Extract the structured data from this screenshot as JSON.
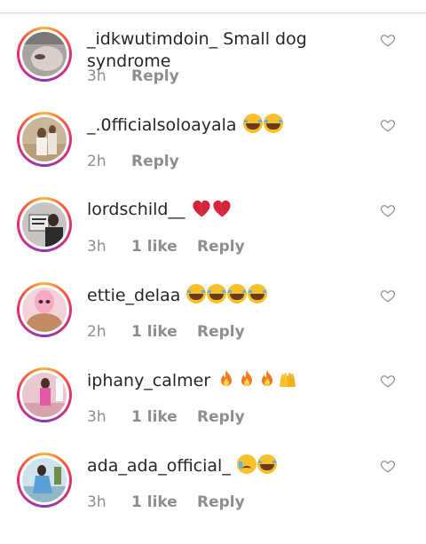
{
  "comments": [
    {
      "username": "_idkwutimdoin_",
      "text": "Small dog syndrome",
      "emojis": [],
      "time": "3h",
      "likes": "",
      "reply": "Reply",
      "avatar": "grey-face-avatar"
    },
    {
      "username": "_.0fficialsoloayala",
      "text": "",
      "emojis": [
        "face-with-tears-of-joy",
        "face-with-tears-of-joy"
      ],
      "time": "2h",
      "likes": "",
      "reply": "Reply",
      "avatar": "white-outfit-avatar"
    },
    {
      "username": "lordschild__",
      "text": "",
      "emojis": [
        "broken-heart",
        "broken-heart"
      ],
      "time": "3h",
      "likes": "1 like",
      "reply": "Reply",
      "avatar": "sign-holder-avatar"
    },
    {
      "username": "ettie_delaa",
      "text": "",
      "emojis": [
        "face-with-tears-of-joy",
        "face-with-tears-of-joy",
        "face-with-tears-of-joy",
        "face-with-tears-of-joy"
      ],
      "time": "2h",
      "likes": "1 like",
      "reply": "Reply",
      "avatar": "pink-mask-avatar"
    },
    {
      "username": "iphany_calmer",
      "text": "",
      "emojis": [
        "fire",
        "fire",
        "fire",
        "raising-hands"
      ],
      "time": "3h",
      "likes": "1 like",
      "reply": "Reply",
      "avatar": "pink-room-avatar"
    },
    {
      "username": "ada_ada_official_",
      "text": "",
      "emojis": [
        "crying-face",
        "face-with-tears-of-joy"
      ],
      "time": "3h",
      "likes": "1 like",
      "reply": "Reply",
      "avatar": "outdoor-avatar"
    }
  ],
  "colors": {
    "text": "#262626",
    "meta": "#8e8e8e",
    "ring_start": "#f7b733",
    "ring_end": "#c13584"
  }
}
